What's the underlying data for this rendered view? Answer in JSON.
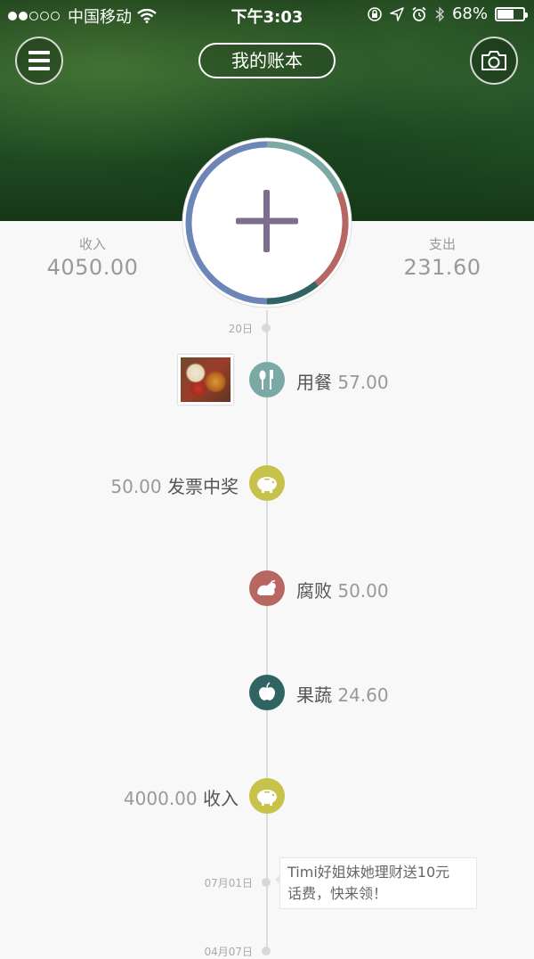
{
  "status": {
    "carrier": "中国移动",
    "time": "下午3:03",
    "battery": "68%",
    "battery_level": 0.68
  },
  "header": {
    "title": "我的账本"
  },
  "summary": {
    "income_label": "收入",
    "income_value": "4050.00",
    "expense_label": "支出",
    "expense_value": "231.60"
  },
  "colors": {
    "dining": "#7aa9a6",
    "corruption": "#b86661",
    "fruit": "#2f6463",
    "income": "#c7c24a",
    "ring_blue": "#6c86b8"
  },
  "timeline": {
    "date1": "20日",
    "entries": [
      {
        "name": "用餐",
        "amount": "57.00",
        "icon": "utensils-icon"
      },
      {
        "name": "发票中奖",
        "amount": "50.00",
        "icon": "piggy-bank-icon"
      },
      {
        "name": "腐败",
        "amount": "50.00",
        "icon": "chicken-icon"
      },
      {
        "name": "果蔬",
        "amount": "24.60",
        "icon": "apple-icon"
      },
      {
        "name": "收入",
        "amount": "4000.00",
        "icon": "piggy-bank-icon"
      }
    ],
    "date2": "07月01日",
    "date3": "04月07日"
  },
  "promo": {
    "line1": "Timi好姐妹她理财送10元",
    "line2": "话费，快来领！"
  }
}
